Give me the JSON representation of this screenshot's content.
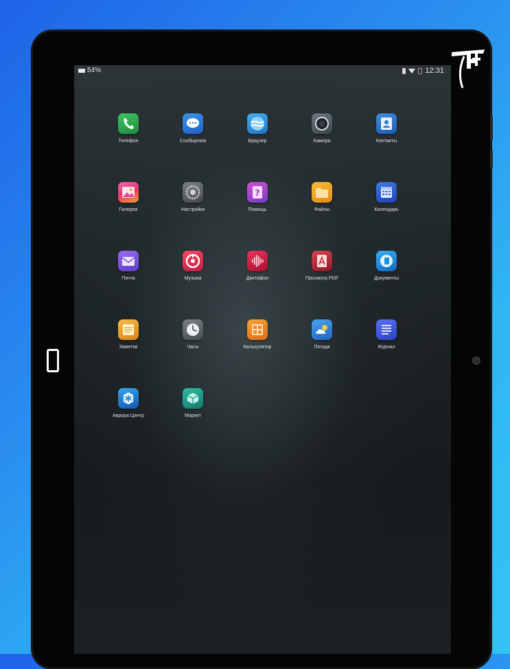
{
  "status_bar": {
    "battery": "54%",
    "time": "12:31"
  },
  "apps": [
    {
      "label": "Телефон",
      "icon": "phone-icon",
      "color": "#2fa84f"
    },
    {
      "label": "Сообщения",
      "icon": "messages-icon",
      "color": "#2d7fd8"
    },
    {
      "label": "Браузер",
      "icon": "browser-icon",
      "color": "#2b8fd6"
    },
    {
      "label": "Камера",
      "icon": "camera-icon",
      "color": "#5b6770"
    },
    {
      "label": "Контакты",
      "icon": "contacts-icon",
      "color": "#2c7ad3"
    },
    {
      "label": "Галерея",
      "icon": "gallery-icon",
      "color": "#e8468f"
    },
    {
      "label": "Настройки",
      "icon": "settings-icon",
      "color": "#5f656b"
    },
    {
      "label": "Помощь",
      "icon": "help-icon",
      "color": "#b03fd1"
    },
    {
      "label": "Файлы",
      "icon": "files-icon",
      "color": "#f0a323"
    },
    {
      "label": "Календарь",
      "icon": "calendar-icon",
      "color": "#2b62d6"
    },
    {
      "label": "Почта",
      "icon": "mail-icon",
      "color": "#7b4fd8"
    },
    {
      "label": "Музыка",
      "icon": "music-icon",
      "color": "#e0304f"
    },
    {
      "label": "Диктофон",
      "icon": "recorder-icon",
      "color": "#d21f45"
    },
    {
      "label": "Просмотр PDF",
      "icon": "pdf-viewer-icon",
      "color": "#c9283b"
    },
    {
      "label": "Документы",
      "icon": "documents-icon",
      "color": "#1c8fe0"
    },
    {
      "label": "Заметки",
      "icon": "notes-icon",
      "color": "#f0a12a"
    },
    {
      "label": "Часы",
      "icon": "clock-icon",
      "color": "#60676d"
    },
    {
      "label": "Калькулятор",
      "icon": "calculator-icon",
      "color": "#f28a1f"
    },
    {
      "label": "Погода",
      "icon": "weather-icon",
      "color": "#2e8ad8"
    },
    {
      "label": "Журнал",
      "icon": "journal-icon",
      "color": "#3d59d6"
    },
    {
      "label": "Аврора Центр",
      "icon": "aurora-center-icon",
      "color": "#1d86d4"
    },
    {
      "label": "Маркет",
      "icon": "market-icon",
      "color": "#21a08f"
    }
  ]
}
